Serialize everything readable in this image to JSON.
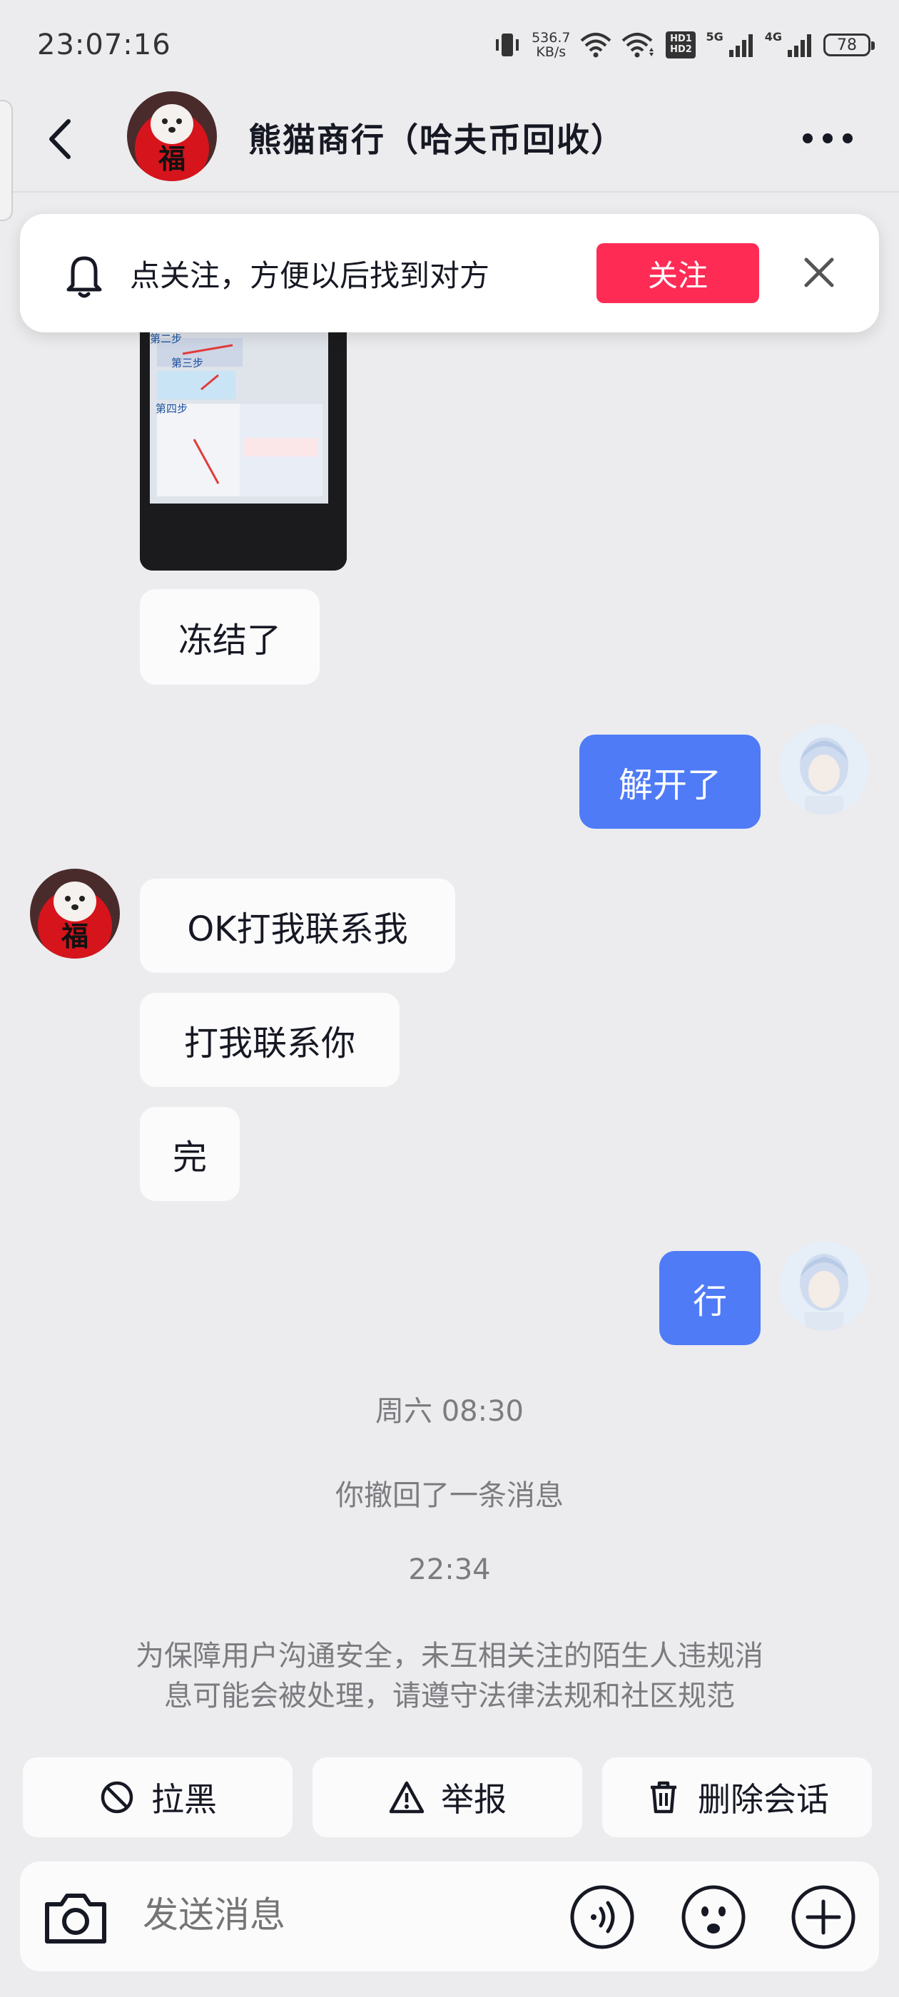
{
  "status_bar": {
    "time": "23:07:16",
    "speed_value": "536.7",
    "speed_unit": "KB/s",
    "hd1": "HD1",
    "hd2": "HD2",
    "net1": "5G",
    "net2": "4G",
    "battery": "78"
  },
  "header": {
    "title": "熊猫商行（哈夫币回收）",
    "avatar_icon": "avatar-dog-red",
    "more_icon": "more-dots-icon"
  },
  "follow_prompt": {
    "text": "点关注，方便以后找到对方",
    "button": "关注",
    "accent": "#fe2c55"
  },
  "image_annotations": [
    "第二步",
    "第三步",
    "第四步"
  ],
  "messages": [
    {
      "side": "in",
      "text": "冻结了"
    },
    {
      "side": "out",
      "text": "解开了"
    },
    {
      "side": "in",
      "text": "OK打我联系我"
    },
    {
      "side": "in",
      "text": "打我联系你"
    },
    {
      "side": "in",
      "text": "完"
    },
    {
      "side": "out",
      "text": "行"
    }
  ],
  "timestamps": [
    "周六 08:30",
    "22:34"
  ],
  "system": {
    "recalled": "你撤回了一条消息",
    "notice_line1": "为保障用户沟通安全，未互相关注的陌生人违规消",
    "notice_line2": "息可能会被处理，请遵守法律法规和社区规范"
  },
  "actions": {
    "block": "拉黑",
    "report": "举报",
    "delete": "删除会话"
  },
  "input": {
    "placeholder": "发送消息"
  },
  "colors": {
    "out_bubble": "#4f7bf7",
    "background": "#ececee"
  }
}
